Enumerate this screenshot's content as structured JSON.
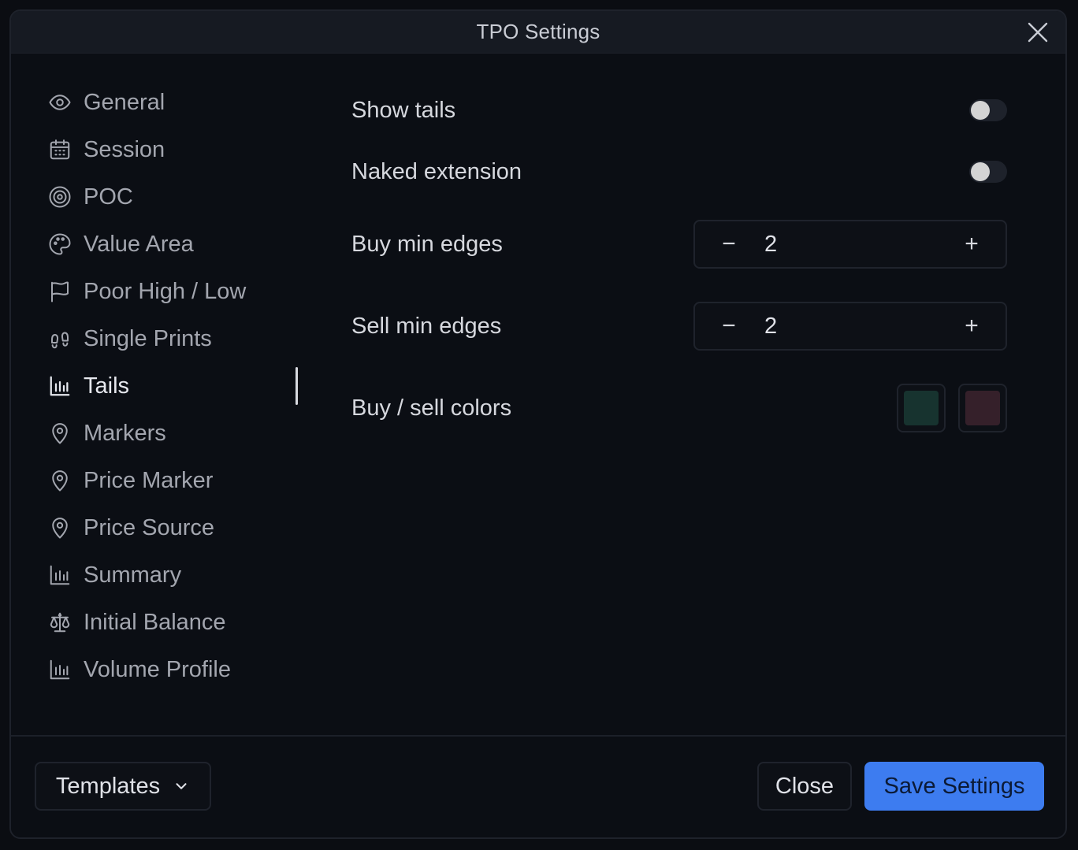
{
  "dialog": {
    "title": "TPO Settings"
  },
  "sidebar": {
    "items": [
      {
        "label": "General",
        "icon": "eye-icon"
      },
      {
        "label": "Session",
        "icon": "calendar-icon"
      },
      {
        "label": "POC",
        "icon": "target-icon"
      },
      {
        "label": "Value Area",
        "icon": "palette-icon"
      },
      {
        "label": "Poor High / Low",
        "icon": "flag-icon"
      },
      {
        "label": "Single Prints",
        "icon": "footprints-icon"
      },
      {
        "label": "Tails",
        "icon": "bar-chart-icon"
      },
      {
        "label": "Markers",
        "icon": "map-pin-icon"
      },
      {
        "label": "Price Marker",
        "icon": "map-pin-icon"
      },
      {
        "label": "Price Source",
        "icon": "map-pin-icon"
      },
      {
        "label": "Summary",
        "icon": "bar-chart-icon"
      },
      {
        "label": "Initial Balance",
        "icon": "scale-icon"
      },
      {
        "label": "Volume Profile",
        "icon": "bar-chart-icon"
      }
    ],
    "active": "Tails"
  },
  "tails": {
    "show_tails": {
      "label": "Show tails",
      "enabled": false
    },
    "naked_extension": {
      "label": "Naked extension",
      "enabled": false
    },
    "buy_min_edges": {
      "label": "Buy min edges",
      "value": "2",
      "minus": "−",
      "plus": "+"
    },
    "sell_min_edges": {
      "label": "Sell min edges",
      "value": "2",
      "minus": "−",
      "plus": "+"
    },
    "buy_sell_colors": {
      "label": "Buy / sell colors",
      "buy_color": "#17332f",
      "sell_color": "#35202a"
    }
  },
  "footer": {
    "templates_label": "Templates",
    "close_label": "Close",
    "save_label": "Save Settings"
  },
  "colors": {
    "accent": "#3d7cf0",
    "background": "#0b0e14"
  }
}
